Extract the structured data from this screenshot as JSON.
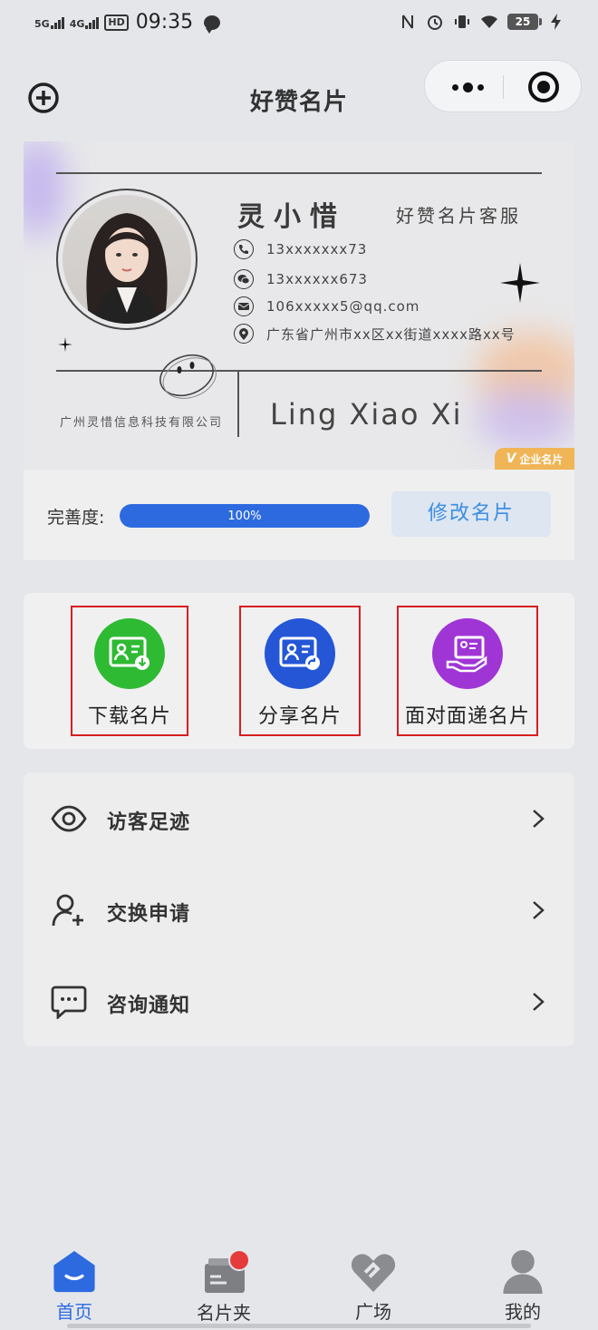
{
  "status_bar": {
    "network1": "5G",
    "network2": "4G",
    "hd": "HD",
    "time": "09:35",
    "battery": "25"
  },
  "header": {
    "title": "好赞名片"
  },
  "card": {
    "name": "灵小惜",
    "role": "好赞名片客服",
    "phone": "13xxxxxxx73",
    "wechat": "13xxxxxx673",
    "email": "106xxxxx5@qq.com",
    "address": "广东省广州市xx区xx街道xxxx路xx号",
    "company": "广州灵惜信息科技有限公司",
    "pinyin_name": "Ling Xiao Xi",
    "badge_v": "V",
    "badge_label": "企业名片"
  },
  "completeness": {
    "label": "完善度:",
    "percent": 100,
    "percent_text": "100%",
    "edit_label": "修改名片"
  },
  "actions": [
    {
      "label": "下载名片",
      "color": "#2fba33",
      "icon": "download-card-icon"
    },
    {
      "label": "分享名片",
      "color": "#2456d6",
      "icon": "share-card-icon"
    },
    {
      "label": "面对面递名片",
      "color": "#a035d6",
      "icon": "hand-card-icon"
    }
  ],
  "menu": [
    {
      "label": "访客足迹",
      "icon": "eye-icon"
    },
    {
      "label": "交换申请",
      "icon": "add-user-icon"
    },
    {
      "label": "咨询通知",
      "icon": "chat-icon"
    }
  ],
  "tabs": [
    {
      "label": "首页",
      "icon": "home-icon",
      "active": true
    },
    {
      "label": "名片夹",
      "icon": "card-holder-icon",
      "active": false
    },
    {
      "label": "广场",
      "icon": "plaza-icon",
      "active": false
    },
    {
      "label": "我的",
      "icon": "profile-icon",
      "active": false
    }
  ],
  "colors": {
    "primary": "#2d6ae0",
    "highlight_border": "#d81e1e",
    "badge": "#f0b556",
    "tab_badge": "#e53b3b"
  }
}
